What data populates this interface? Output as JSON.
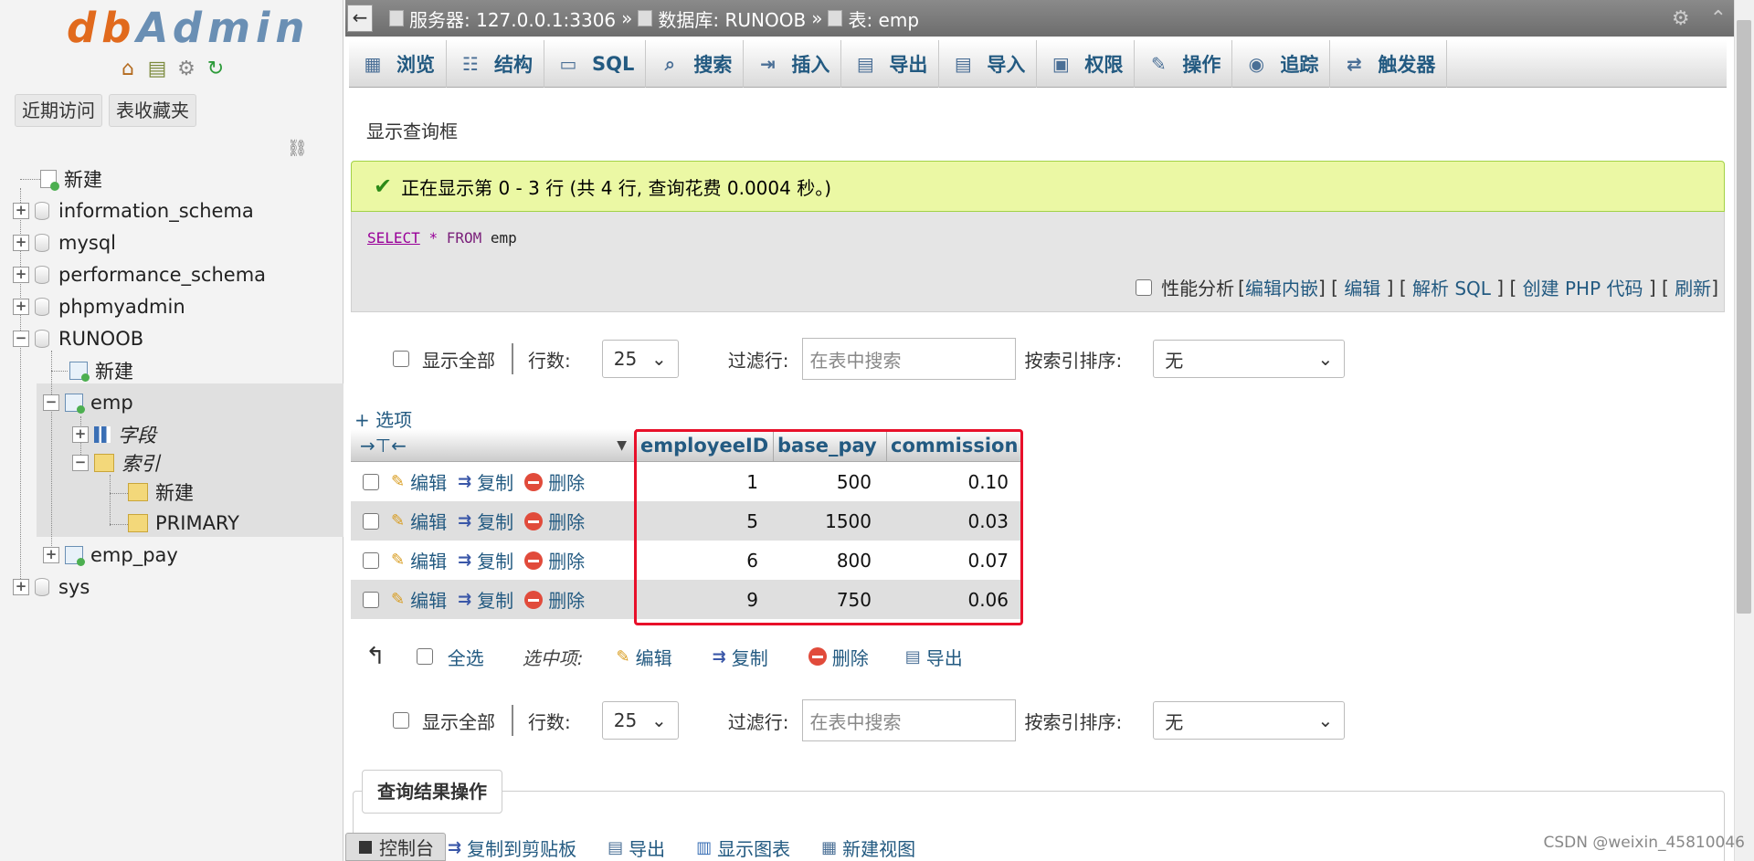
{
  "nav": {
    "logo": "dbAdmin",
    "logo_icons": [
      "home-icon",
      "exit-icon",
      "settings-icon",
      "reload-icon"
    ],
    "btn_recent": "近期访问",
    "btn_favorites": "表收藏夹",
    "tree": {
      "new": "新建",
      "db1": "information_schema",
      "db2": "mysql",
      "db3": "performance_schema",
      "db4": "phpmyadmin",
      "db5": "RUNOOB",
      "runoob_new": "新建",
      "table_emp": "emp",
      "columns": "字段",
      "indexes": "索引",
      "index_new": "新建",
      "index_primary": "PRIMARY",
      "table_emp_pay": "emp_pay",
      "db6": "sys"
    }
  },
  "topbar": {
    "back": "←",
    "server": "服务器: 127.0.0.1:3306",
    "sep": "»",
    "database": "数据库: RUNOOB",
    "table": "表: emp"
  },
  "tabs": [
    {
      "label": "浏览",
      "icon": "browse-icon"
    },
    {
      "label": "结构",
      "icon": "structure-icon"
    },
    {
      "label": "SQL",
      "icon": "sql-icon"
    },
    {
      "label": "搜索",
      "icon": "search-icon"
    },
    {
      "label": "插入",
      "icon": "insert-icon"
    },
    {
      "label": "导出",
      "icon": "export-icon"
    },
    {
      "label": "导入",
      "icon": "import-icon"
    },
    {
      "label": "权限",
      "icon": "privileges-icon"
    },
    {
      "label": "操作",
      "icon": "operations-icon"
    },
    {
      "label": "追踪",
      "icon": "tracking-icon"
    },
    {
      "label": "触发器",
      "icon": "triggers-icon"
    }
  ],
  "main": {
    "query_box_label": "显示查询框",
    "success_msg": "正在显示第 0 - 3 行 (共 4 行, 查询花费 0.0004 秒。)",
    "sql": {
      "select": "SELECT",
      "star": "*",
      "from": "FROM",
      "table": "emp"
    },
    "sql_links": {
      "profiling": "性能分析",
      "edit_inline": "编辑内嵌",
      "edit": "编辑",
      "explain": "解析 SQL",
      "php": "创建 PHP 代码",
      "refresh": "刷新"
    },
    "controls": {
      "show_all": "显示全部",
      "rows_label": "行数:",
      "rows_value": "25",
      "filter_label": "过滤行:",
      "filter_placeholder": "在表中搜索",
      "sort_label": "按索引排序:",
      "sort_value": "无"
    },
    "options_link": "+ 选项",
    "columns": [
      "employeeID",
      "base_pay",
      "commission"
    ],
    "row_actions": {
      "edit": "编辑",
      "copy": "复制",
      "delete": "删除"
    },
    "rows": [
      {
        "employeeID": "1",
        "base_pay": "500",
        "commission": "0.10"
      },
      {
        "employeeID": "5",
        "base_pay": "1500",
        "commission": "0.03"
      },
      {
        "employeeID": "6",
        "base_pay": "800",
        "commission": "0.07"
      },
      {
        "employeeID": "9",
        "base_pay": "750",
        "commission": "0.06"
      }
    ],
    "bulk": {
      "check_all": "全选",
      "with_selected": "选中项:",
      "edit": "编辑",
      "copy": "复制",
      "delete": "删除",
      "export": "导出"
    },
    "query_ops": {
      "title": "查询结果操作",
      "copy_clipboard": "复制到剪贴板",
      "export": "导出",
      "show_chart": "显示图表",
      "create_view": "新建视图"
    },
    "console": "控制台"
  },
  "watermark": "CSDN @weixin_45810046",
  "colors": {
    "link": "#235a81",
    "success_bg": "#ebf8a4",
    "highlight": "#e8102a",
    "logo": "#e16a1d"
  }
}
